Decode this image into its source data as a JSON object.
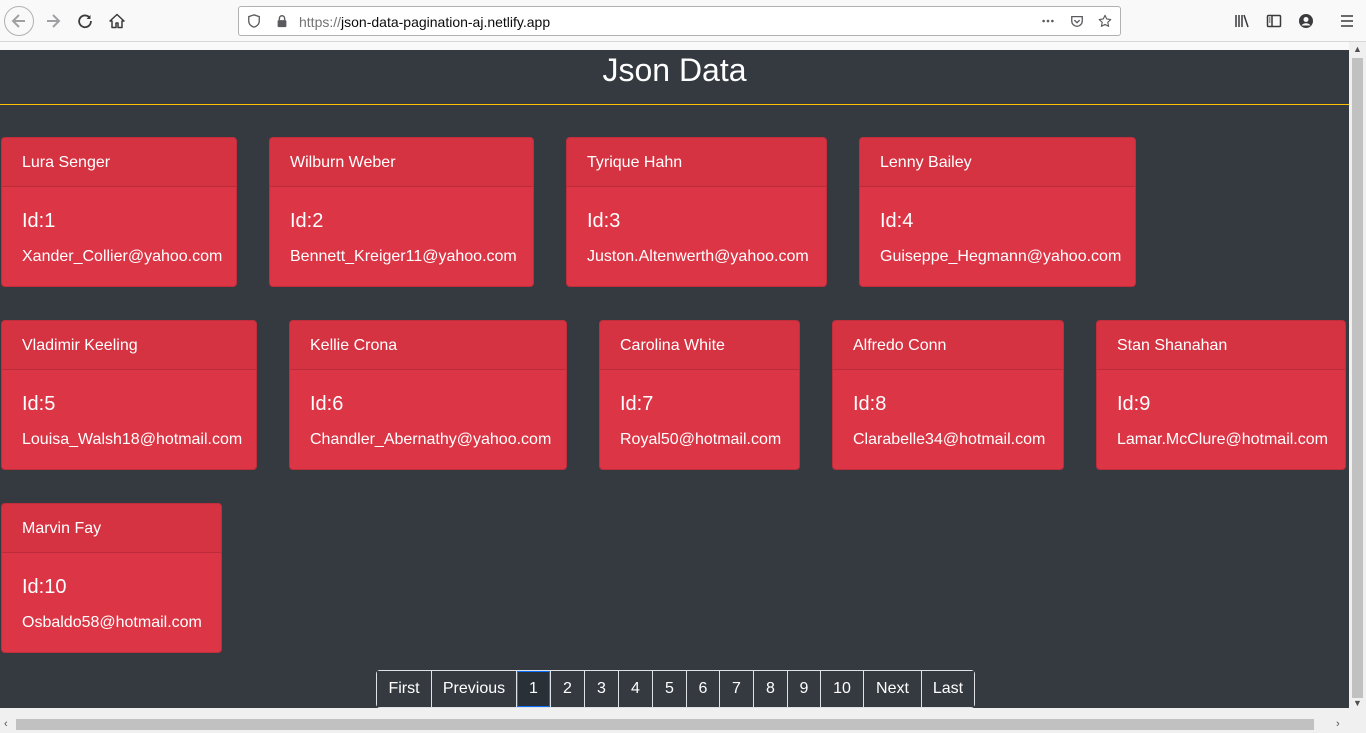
{
  "browser": {
    "url_prefix": "https://",
    "url_host": "json-data-pagination-aj.netlify.app",
    "icons": [
      "back-icon",
      "forward-icon",
      "reload-icon",
      "home-icon",
      "shield-icon",
      "lock-icon",
      "more-icon",
      "pocket-icon",
      "star-icon",
      "library-icon",
      "sidebar-icon",
      "account-icon",
      "menu-icon"
    ]
  },
  "page": {
    "title": "Json Data",
    "accent": "#ffc107",
    "card_color": "#dc3545",
    "background": "#343a40"
  },
  "cards": [
    {
      "name": "Lura Senger",
      "id": "Id:1",
      "email": "Xander_Collier@yahoo.com"
    },
    {
      "name": "Wilburn Weber",
      "id": "Id:2",
      "email": "Bennett_Kreiger11@yahoo.com"
    },
    {
      "name": "Tyrique Hahn",
      "id": "Id:3",
      "email": "Juston.Altenwerth@yahoo.com"
    },
    {
      "name": "Lenny Bailey",
      "id": "Id:4",
      "email": "Guiseppe_Hegmann@yahoo.com"
    },
    {
      "name": "Vladimir Keeling",
      "id": "Id:5",
      "email": "Louisa_Walsh18@hotmail.com"
    },
    {
      "name": "Kellie Crona",
      "id": "Id:6",
      "email": "Chandler_Abernathy@yahoo.com"
    },
    {
      "name": "Carolina White",
      "id": "Id:7",
      "email": "Royal50@hotmail.com"
    },
    {
      "name": "Alfredo Conn",
      "id": "Id:8",
      "email": "Clarabelle34@hotmail.com"
    },
    {
      "name": "Stan Shanahan",
      "id": "Id:9",
      "email": "Lamar.McClure@hotmail.com"
    },
    {
      "name": "Marvin Fay",
      "id": "Id:10",
      "email": "Osbaldo58@hotmail.com"
    }
  ],
  "pagination": {
    "first": "First",
    "previous": "Previous",
    "pages": [
      "1",
      "2",
      "3",
      "4",
      "5",
      "6",
      "7",
      "8",
      "9",
      "10"
    ],
    "next": "Next",
    "last": "Last",
    "current": "1"
  }
}
